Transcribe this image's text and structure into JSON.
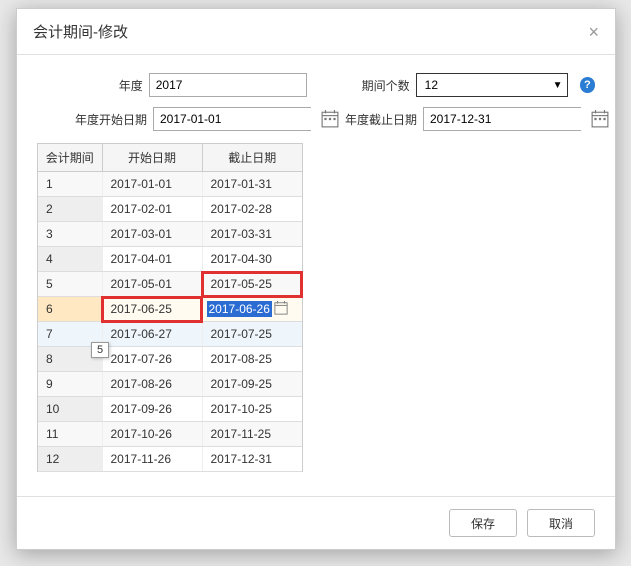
{
  "header": {
    "title": "会计期间-修改"
  },
  "form": {
    "year_label": "年度",
    "year_value": "2017",
    "count_label": "期间个数",
    "count_value": "12",
    "start_label": "年度开始日期",
    "start_value": "2017-01-01",
    "end_label": "年度截止日期",
    "end_value": "2017-12-31"
  },
  "table": {
    "columns": {
      "period": "会计期间",
      "start": "开始日期",
      "end": "截止日期"
    },
    "rows": [
      {
        "period": "1",
        "start": "2017-01-01",
        "end": "2017-01-31"
      },
      {
        "period": "2",
        "start": "2017-02-01",
        "end": "2017-02-28"
      },
      {
        "period": "3",
        "start": "2017-03-01",
        "end": "2017-03-31"
      },
      {
        "period": "4",
        "start": "2017-04-01",
        "end": "2017-04-30"
      },
      {
        "period": "5",
        "start": "2017-05-01",
        "end": "2017-05-25"
      },
      {
        "period": "6",
        "start": "2017-06-25",
        "end": "2017-06-26"
      },
      {
        "period": "7",
        "start": "2017-06-27",
        "end": "2017-07-25"
      },
      {
        "period": "8",
        "start": "2017-07-26",
        "end": "2017-08-25"
      },
      {
        "period": "9",
        "start": "2017-08-26",
        "end": "2017-09-25"
      },
      {
        "period": "10",
        "start": "2017-09-26",
        "end": "2017-10-25"
      },
      {
        "period": "11",
        "start": "2017-10-26",
        "end": "2017-11-25"
      },
      {
        "period": "12",
        "start": "2017-11-26",
        "end": "2017-12-31"
      }
    ],
    "editing_row_index": 5,
    "tooltip_value": "5"
  },
  "footer": {
    "save": "保存",
    "cancel": "取消"
  }
}
